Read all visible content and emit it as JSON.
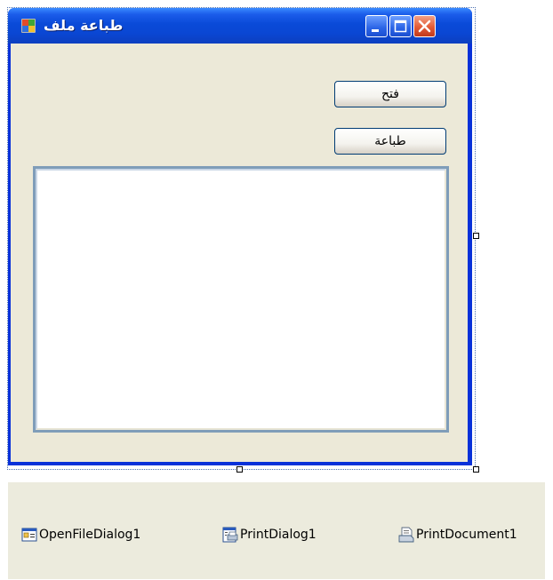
{
  "window": {
    "title": "طباعة ملف",
    "minimize_label": "Minimize",
    "maximize_label": "Maximize",
    "close_label": "Close"
  },
  "form": {
    "open_button_label": "فتح",
    "print_button_label": "طباعة",
    "textbox_value": ""
  },
  "component_tray": {
    "items": [
      {
        "label": "OpenFileDialog1",
        "icon": "open-file-dialog-icon"
      },
      {
        "label": "PrintDialog1",
        "icon": "print-dialog-icon"
      },
      {
        "label": "PrintDocument1",
        "icon": "print-document-icon"
      }
    ]
  },
  "colors": {
    "titlebar": "#0a47d4",
    "client_background": "#ece9d8",
    "tray_background": "#ecebdd",
    "close_button": "#e35b36"
  }
}
